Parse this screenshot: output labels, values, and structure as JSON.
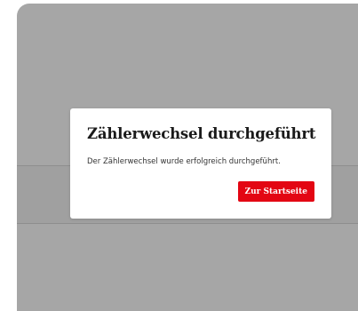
{
  "dialog": {
    "title": "Zählerwechsel durchgeführt",
    "message": "Der Zählerwechsel wurde erfolgreich durchgeführt.",
    "button_label": "Zur Startseite"
  },
  "colors": {
    "accent": "#e30613",
    "overlay": "#a6a6a6"
  }
}
